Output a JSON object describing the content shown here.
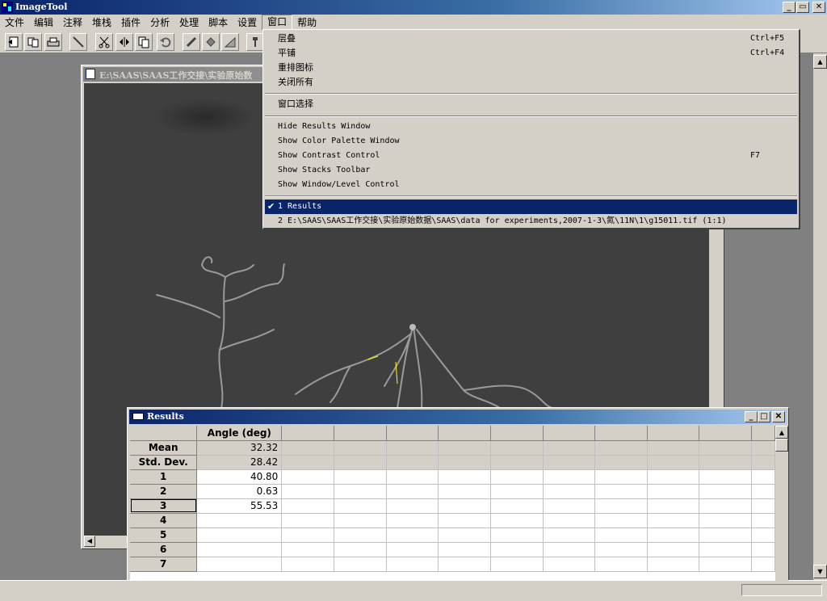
{
  "app": {
    "title": "ImageTool"
  },
  "menubar": {
    "items": [
      "文件",
      "编辑",
      "注释",
      "堆栈",
      "插件",
      "分析",
      "处理",
      "脚本",
      "设置",
      "窗口",
      "帮助"
    ],
    "active_index": 9
  },
  "toolbar": {
    "icons": [
      "open-icon",
      "save-icon",
      "print-icon",
      "line-tool-icon",
      "cut-icon",
      "flip-icon",
      "copy-icon",
      "undo-icon",
      "pencil-icon",
      "fill-icon",
      "wedge-icon",
      "tool-icon"
    ]
  },
  "image_window": {
    "title": "E:\\SAAS\\SAAS工作交接\\实验原始数"
  },
  "window_menu": {
    "cascade": {
      "label": "层叠",
      "shortcut": "Ctrl+F5"
    },
    "tile": {
      "label": "平铺",
      "shortcut": "Ctrl+F4"
    },
    "arrange": {
      "label": "重排图标"
    },
    "close_all": {
      "label": "关闭所有"
    },
    "select": {
      "label": "窗口选择"
    },
    "hide_results": {
      "label": "Hide Results Window"
    },
    "color_palette": {
      "label": "Show Color Palette Window"
    },
    "contrast": {
      "label": "Show Contrast Control",
      "shortcut": "F7"
    },
    "stacks_toolbar": {
      "label": "Show Stacks Toolbar"
    },
    "window_level": {
      "label": "Show Window/Level Control"
    },
    "win1": {
      "label": "1 Results",
      "checked": true
    },
    "win2": {
      "label": "2 E:\\SAAS\\SAAS工作交接\\实验原始数据\\SAAS\\data for experiments,2007-1-3\\氮\\11N\\1\\g15011.tif (1:1)"
    }
  },
  "results_window": {
    "title": "Results",
    "column_header": "Angle (deg)",
    "rows": [
      {
        "label": "Mean",
        "value": "32.32"
      },
      {
        "label": "Std. Dev.",
        "value": "28.42"
      },
      {
        "label": "1",
        "value": "40.80"
      },
      {
        "label": "2",
        "value": "0.63"
      },
      {
        "label": "3",
        "value": "55.53"
      },
      {
        "label": "4",
        "value": ""
      },
      {
        "label": "5",
        "value": ""
      },
      {
        "label": "6",
        "value": ""
      },
      {
        "label": "7",
        "value": ""
      }
    ]
  },
  "colors": {
    "active_caption": "#0a246a",
    "face": "#d4d0c8",
    "mdi_background": "#808080",
    "selection": "#0a246a"
  }
}
